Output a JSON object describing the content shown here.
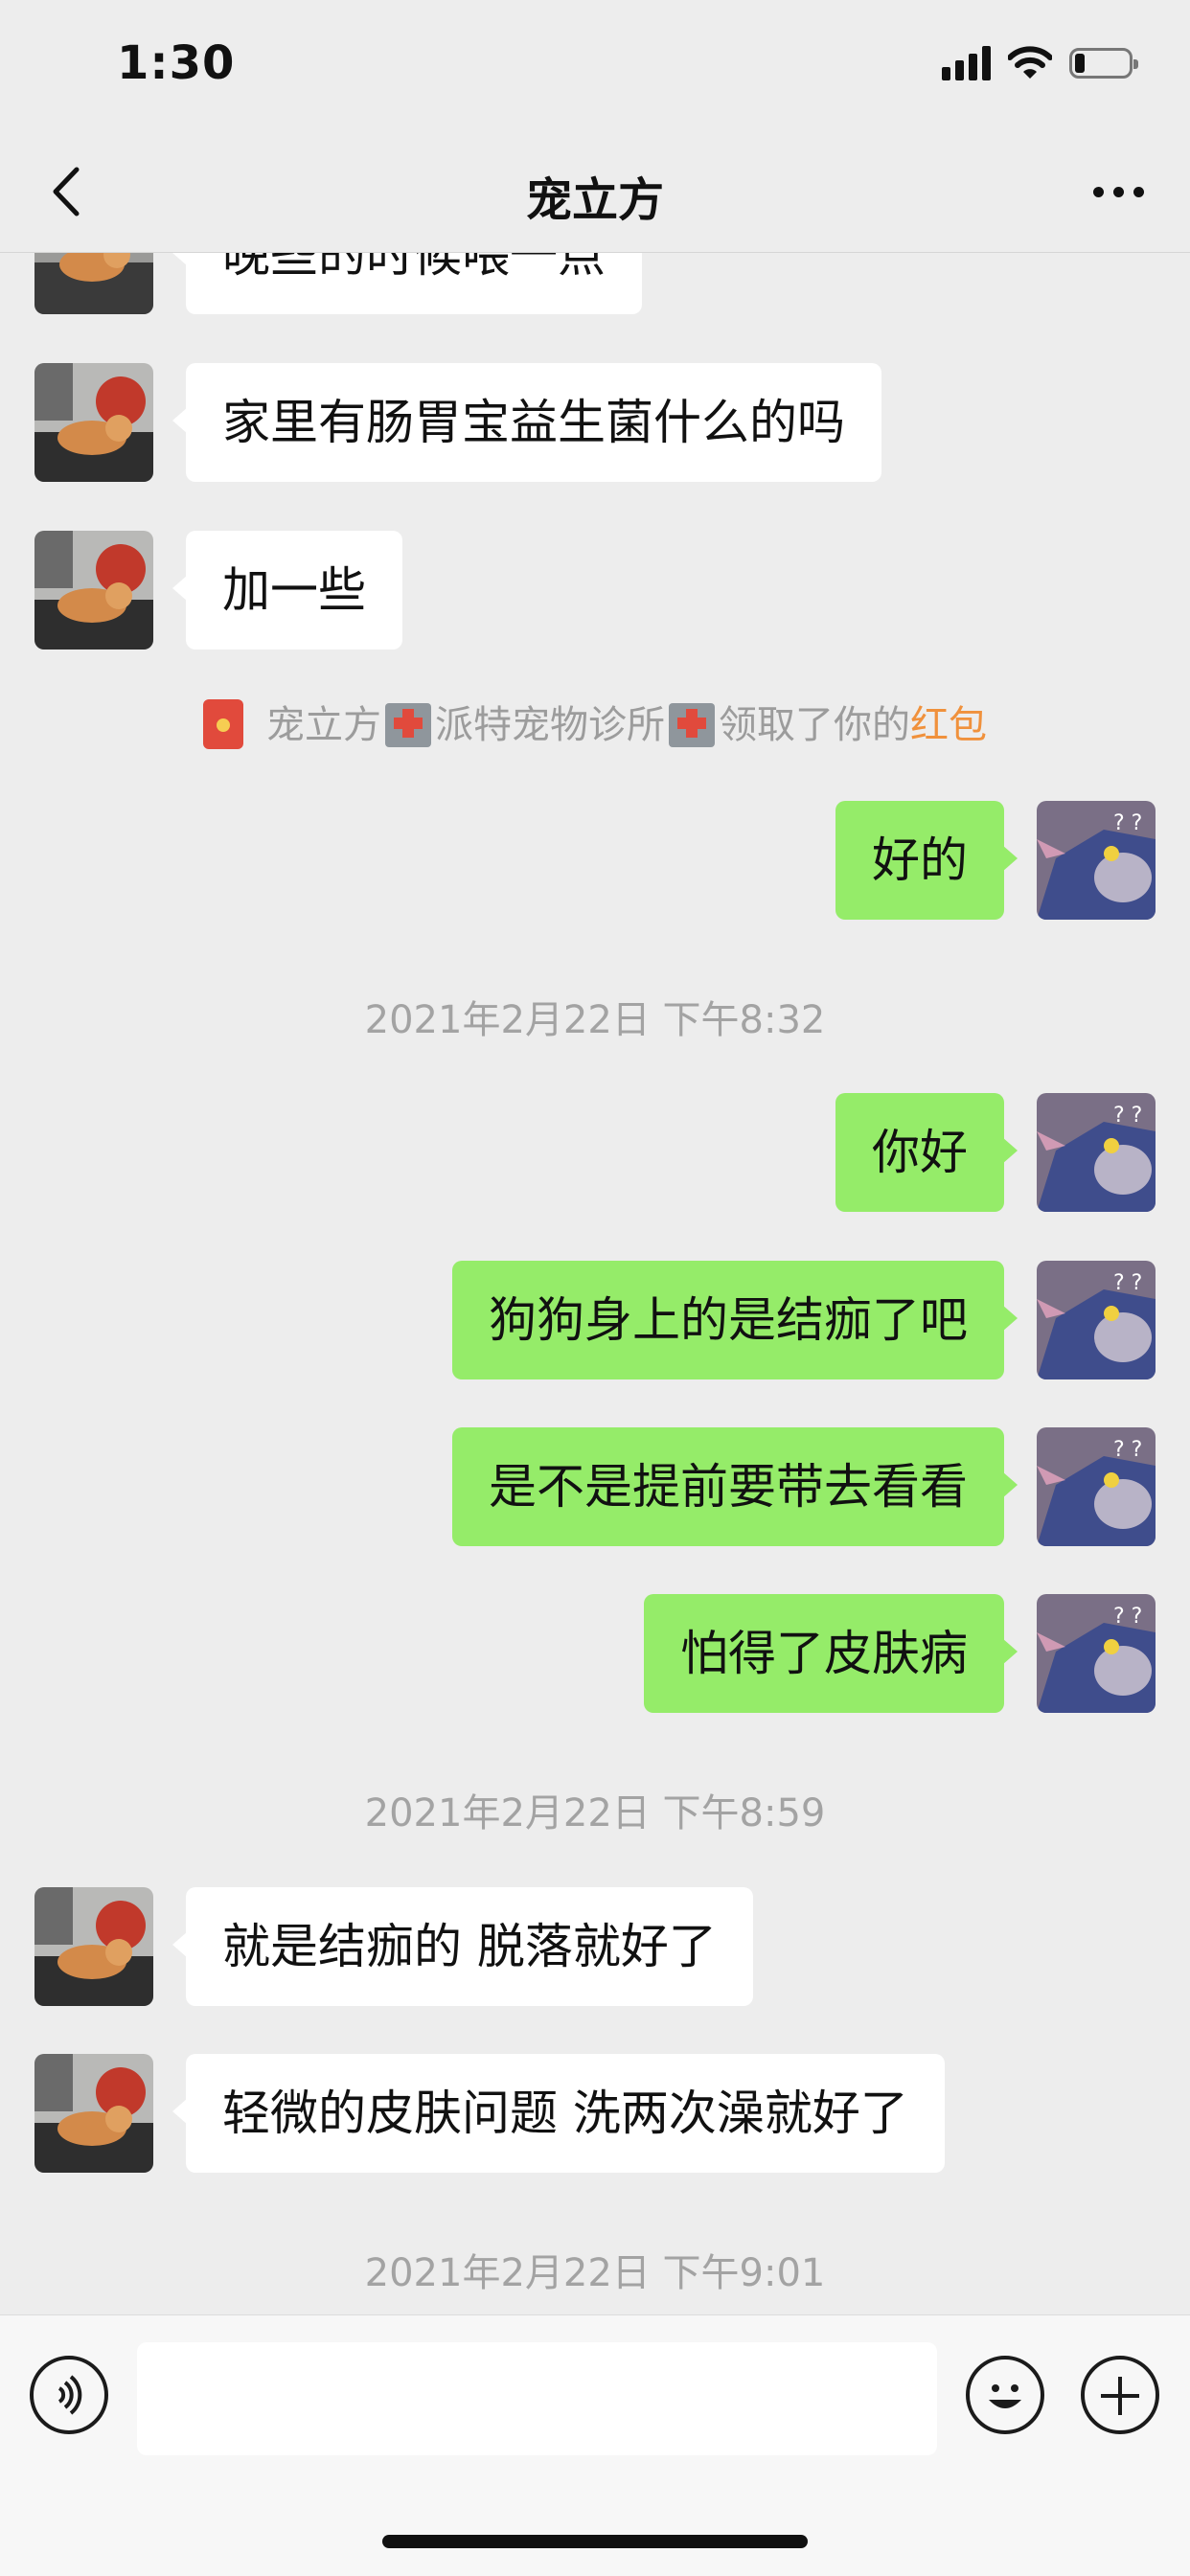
{
  "status_bar": {
    "time": "1:30",
    "battery_level": 0.15
  },
  "nav": {
    "title": "宠立方",
    "back_icon": "chevron-left-icon",
    "more_icon": "ellipsis-icon"
  },
  "messages": [
    {
      "type": "received",
      "text": "晚些的时候喂一点"
    },
    {
      "type": "received",
      "text": "家里有肠胃宝益生菌什么的吗"
    },
    {
      "type": "received",
      "text": "加一些"
    },
    {
      "type": "system",
      "parts": {
        "name1": "宠立方",
        "name2": "派特宠物诊所",
        "action": "领取了你的",
        "link": "红包"
      }
    },
    {
      "type": "sent",
      "text": "好的"
    },
    {
      "type": "timestamp",
      "text": "2021年2月22日 下午8:32"
    },
    {
      "type": "sent",
      "text": "你好"
    },
    {
      "type": "sent",
      "text": "狗狗身上的是结痂了吧"
    },
    {
      "type": "sent",
      "text": "是不是提前要带去看看"
    },
    {
      "type": "sent",
      "text": "怕得了皮肤病"
    },
    {
      "type": "timestamp",
      "text": "2021年2月22日 下午8:59"
    },
    {
      "type": "received",
      "text": "就是结痂的 脱落就好了"
    },
    {
      "type": "received",
      "text": "轻微的皮肤问题  洗两次澡就好了"
    },
    {
      "type": "timestamp",
      "text": "2021年2月22日 下午9:01"
    }
  ],
  "input_bar": {
    "voice_icon": "voice-icon",
    "input_value": "",
    "emoji_icon": "emoji-icon",
    "plus_icon": "plus-icon"
  },
  "colors": {
    "background": "#ededed",
    "sent_bubble": "#95ec69",
    "received_bubble": "#ffffff",
    "link": "#f0913c",
    "timestamp": "#a3a3a3"
  }
}
